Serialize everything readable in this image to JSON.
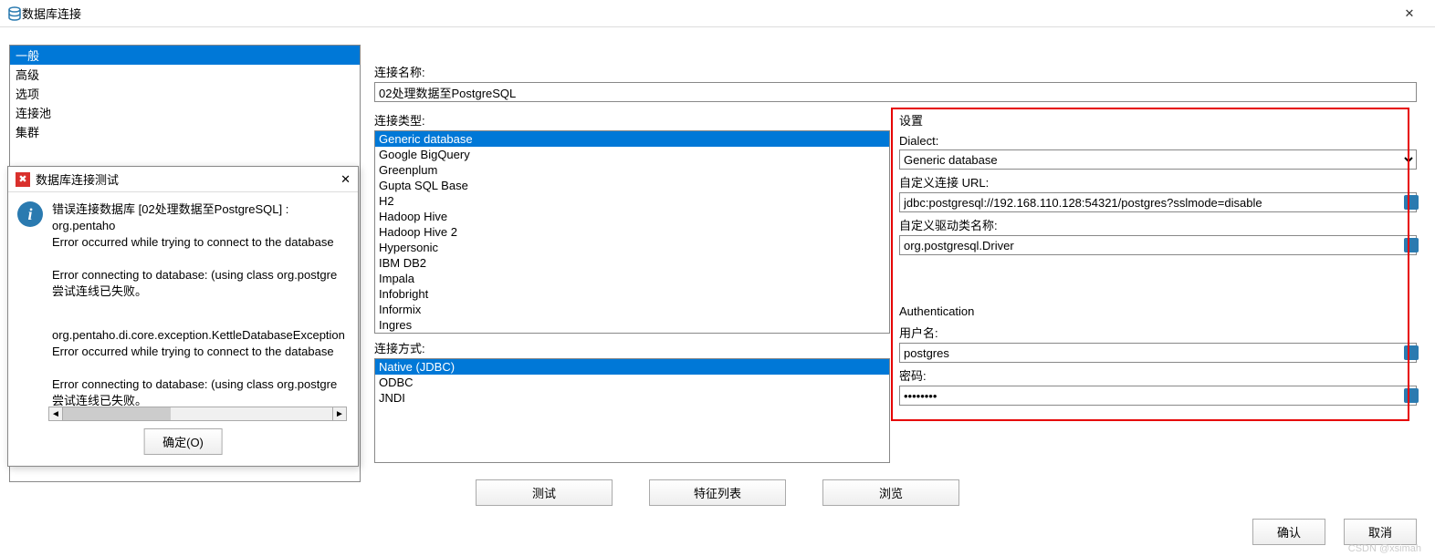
{
  "main_window": {
    "title": "数据库连接",
    "close_glyph": "✕"
  },
  "sidebar": {
    "items": [
      "一般",
      "高级",
      "选项",
      "连接池",
      "集群"
    ],
    "selected": 0
  },
  "form": {
    "conn_name_label": "连接名称:",
    "conn_name_value": "02处理数据至PostgreSQL",
    "conn_type_label": "连接类型:",
    "conn_types": [
      "Generic database",
      "Google BigQuery",
      "Greenplum",
      "Gupta SQL Base",
      "H2",
      "Hadoop Hive",
      "Hadoop Hive 2",
      "Hypersonic",
      "IBM DB2",
      "Impala",
      "Infobright",
      "Informix",
      "Ingres"
    ],
    "conn_type_selected": 0,
    "conn_method_label": "连接方式:",
    "conn_methods": [
      "Native (JDBC)",
      "ODBC",
      "JNDI"
    ],
    "conn_method_selected": 0
  },
  "settings": {
    "group_label": "设置",
    "dialect_label": "Dialect:",
    "dialect_value": "Generic database",
    "url_label": "自定义连接 URL:",
    "url_value": "jdbc:postgresql://192.168.110.128:54321/postgres?sslmode=disable",
    "driver_label": "自定义驱动类名称:",
    "driver_value": "org.postgresql.Driver",
    "auth_label": "Authentication",
    "user_label": "用户名:",
    "user_value": "postgres",
    "pass_label": "密码:",
    "pass_value": "••••••••"
  },
  "buttons": {
    "test": "测试",
    "feature": "特征列表",
    "browse": "浏览",
    "ok": "确认",
    "cancel": "取消"
  },
  "error_dialog": {
    "title": "数据库连接测试",
    "close_glyph": "✕",
    "line1": "错误连接数据库 [02处理数据至PostgreSQL] : org.pentaho",
    "line2": "Error occurred while trying to connect to the database",
    "line3": "Error connecting to database: (using class org.postgre",
    "line4": "尝试连线已失败。",
    "line5": "org.pentaho.di.core.exception.KettleDatabaseException",
    "line6": "Error occurred while trying to connect to the database",
    "line7": "Error connecting to database: (using class org.postgre",
    "line8": "尝试连线已失败。",
    "ok_button": "确定(O)"
  },
  "scroll": {
    "left": "◄",
    "right": "►"
  },
  "watermark": "CSDN @xsimah"
}
